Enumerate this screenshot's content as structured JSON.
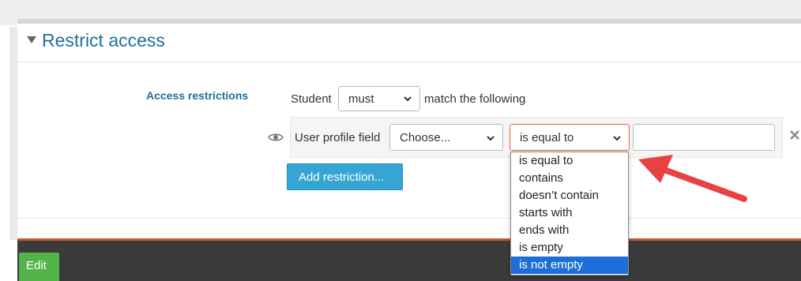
{
  "section": {
    "title": "Restrict access"
  },
  "restrictions": {
    "label": "Access restrictions",
    "prefix": "Student",
    "match_select": "must",
    "suffix": "match the following",
    "rule": {
      "field_label": "User profile field",
      "field_select": "Choose...",
      "operator_select": "is equal to",
      "value_input": ""
    },
    "add_button": "Add restriction..."
  },
  "operator_options": [
    "is equal to",
    "contains",
    "doesn’t contain",
    "starts with",
    "ends with",
    "is empty",
    "is not empty"
  ],
  "selected_option": "is not empty",
  "footer": {
    "edit_button": "Edit"
  },
  "colors": {
    "heading": "#1f6f9a",
    "add_button": "#35a6d3",
    "edit_button": "#53b44a",
    "operator_border": "#e4643a",
    "selected_option": "#1e6fd9",
    "annotation_arrow": "#e84141"
  },
  "icons": {
    "eye": "eye-icon",
    "close": "close-icon",
    "chevron": "chevron-down-icon",
    "collapse": "collapse-triangle-icon"
  }
}
